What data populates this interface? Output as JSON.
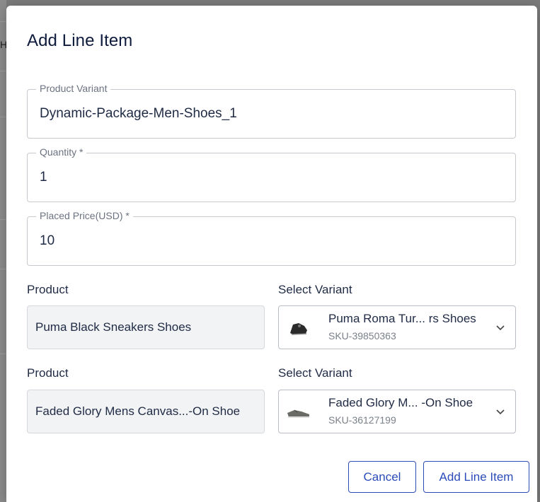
{
  "backdrop": {
    "left_glyph": "H"
  },
  "dialog": {
    "title": "Add Line Item",
    "fields": [
      {
        "legend": "Product Variant",
        "value": "Dynamic-Package-Men-Shoes_1"
      },
      {
        "legend": "Quantity *",
        "value": "1"
      },
      {
        "legend": "Placed Price(USD) *",
        "value": "10"
      }
    ],
    "rows": [
      {
        "product_label": "Product",
        "product_value": "Puma Black Sneakers Shoes",
        "variant_label": "Select Variant",
        "variant_name": "Puma Roma Tur...  rs Shoes",
        "variant_sku": "SKU-39850363"
      },
      {
        "product_label": "Product",
        "product_value": "Faded Glory Mens Canvas...-On Shoe",
        "variant_label": "Select Variant",
        "variant_name": "Faded Glory M...  -On Shoe",
        "variant_sku": "SKU-36127199"
      }
    ],
    "buttons": {
      "cancel": "Cancel",
      "add": "Add Line Item"
    },
    "accent_color": "#2b4bb8"
  }
}
